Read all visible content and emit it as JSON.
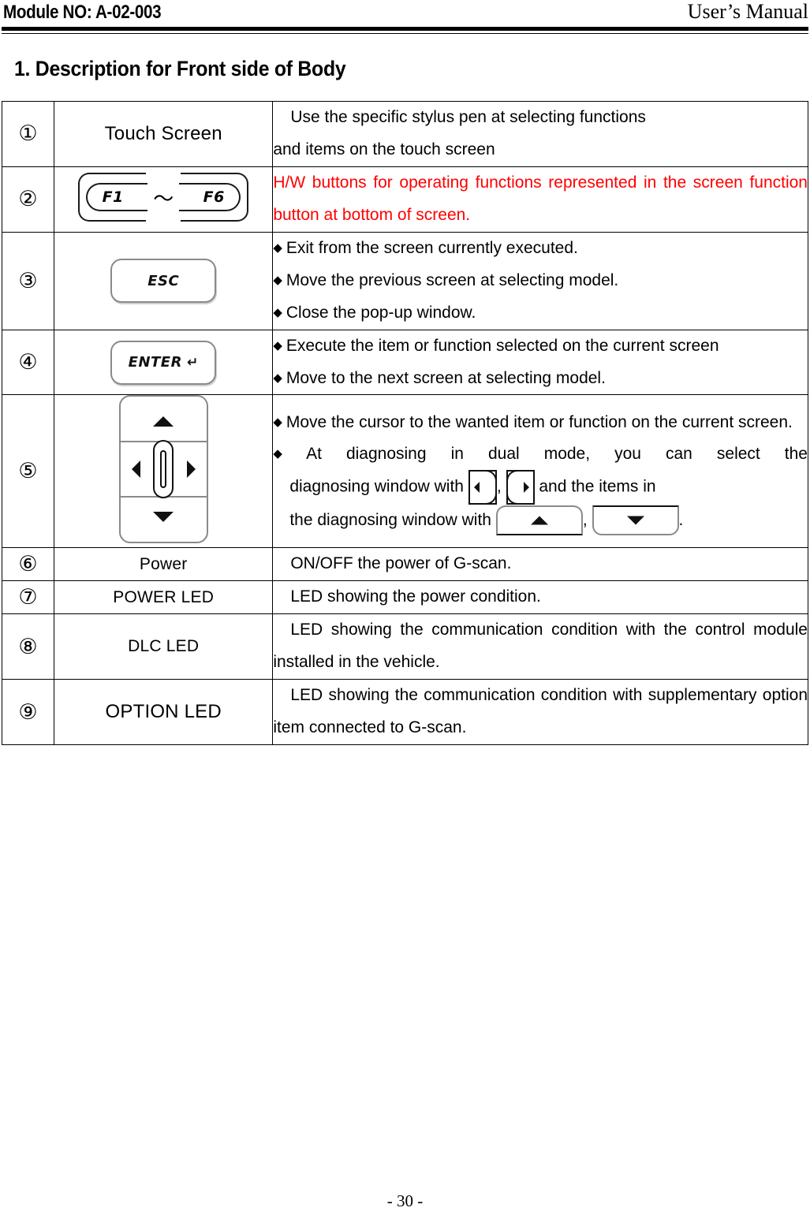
{
  "header": {
    "module_no": "Module NO: A-02-003",
    "manual_title": "User’s Manual"
  },
  "section": {
    "title": "1. Description for Front side of Body"
  },
  "table": {
    "rows": [
      {
        "number": "①",
        "name": "Touch Screen",
        "name_type": "text",
        "desc_lines": [
          "Use the specific stylus pen at selecting functions",
          "and items on the touch screen"
        ],
        "color": "#000000"
      },
      {
        "number": "②",
        "name_type": "fkeys",
        "fkey_left": "F1",
        "fkey_sep": "～",
        "fkey_right": "F6",
        "desc_lines": [
          "H/W buttons for operating functions represented in the screen function button at bottom of screen."
        ],
        "color": "#ff0000"
      },
      {
        "number": "③",
        "name_type": "key",
        "key_label": "ESC",
        "bullets": [
          "Exit from the screen currently executed.",
          "Move the previous screen at selecting model.",
          "Close the pop-up window."
        ],
        "color": "#000000"
      },
      {
        "number": "④",
        "name_type": "key",
        "key_label": "ENTER",
        "key_glyph": "↵",
        "bullets": [
          "Execute the item or function selected on the current screen",
          "Move to the next screen at selecting model."
        ],
        "color": "#000000"
      },
      {
        "number": "⑤",
        "name_type": "dpad",
        "bullets": [
          "Move the cursor to the wanted item or function on the current screen.",
          "At diagnosing in dual mode, you can select the diagnosing window with"
        ],
        "inline_text": {
          "part_a": "At  diagnosing  in  dual  mode,  you  can  select  the",
          "part_b": "diagnosing  window  with",
          "part_c": ",",
          "part_d": "and  the  items  in",
          "part_e": "the diagnosing window with",
          "part_f": ",",
          "part_g": "."
        },
        "color": "#000000"
      },
      {
        "number": "⑥",
        "name": "Power",
        "name_type": "text",
        "name_small": true,
        "desc_lines": [
          "ON/OFF the power of G-scan."
        ],
        "color": "#000000"
      },
      {
        "number": "⑦",
        "name": "POWER LED",
        "name_type": "text",
        "name_small": true,
        "desc_lines": [
          "LED showing the power condition."
        ],
        "color": "#000000"
      },
      {
        "number": "⑧",
        "name": "DLC LED",
        "name_type": "text",
        "name_small": true,
        "desc_lines": [
          "LED showing the communication condition with the control module installed in the vehicle."
        ],
        "color": "#000000"
      },
      {
        "number": "⑨",
        "name": "OPTION LED",
        "name_type": "text",
        "desc_lines": [
          "LED showing the communication condition with supplementary option item connected to G-scan."
        ],
        "color": "#000000"
      }
    ]
  },
  "footer": {
    "page_label": "- 30 -"
  }
}
